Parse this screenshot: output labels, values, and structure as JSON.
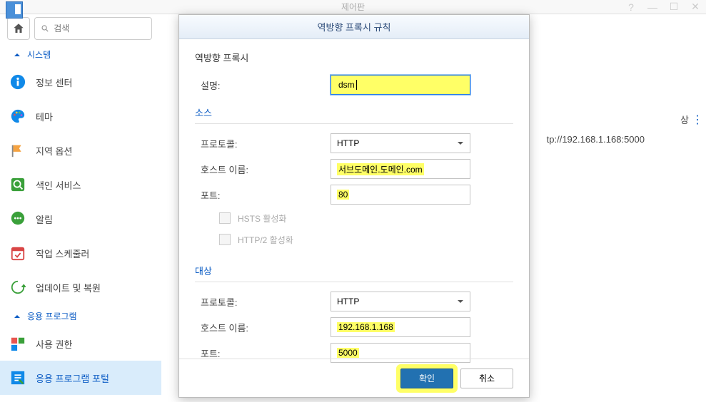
{
  "title": "제어판",
  "search_placeholder": "검색",
  "sidebar": {
    "sections": [
      {
        "label": "시스템",
        "collapsible": true
      }
    ],
    "items": [
      {
        "label": "정보 센터",
        "icon": "info"
      },
      {
        "label": "테마",
        "icon": "palette"
      },
      {
        "label": "지역 옵션",
        "icon": "flags"
      },
      {
        "label": "색인 서비스",
        "icon": "magnify"
      },
      {
        "label": "알림",
        "icon": "chat"
      },
      {
        "label": "작업 스케줄러",
        "icon": "calendar"
      },
      {
        "label": "업데이트 및 복원",
        "icon": "refresh"
      }
    ],
    "app_section_label": "응용 프로그램",
    "app_items": [
      {
        "label": "사용 권한",
        "icon": "perms"
      },
      {
        "label": "응용 프로그램 포털",
        "icon": "portal",
        "active": true
      }
    ]
  },
  "content": {
    "col_target": "상",
    "row_value": "tp://192.168.1.168:5000"
  },
  "modal": {
    "title": "역방향 프록시 규칙",
    "group": "역방향 프록시",
    "desc_label": "설명:",
    "desc_value": "dsm",
    "source_title": "소스",
    "protocol_label": "프로토콜:",
    "protocol_value": "HTTP",
    "host_label": "호스트 이름:",
    "src_host_value": "서브도메인.도메인.com",
    "port_label": "포트:",
    "src_port_value": "80",
    "hsts_label": "HSTS 활성화",
    "http2_label": "HTTP/2 활성화",
    "dest_title": "대상",
    "dest_host_value": "192.168.1.168",
    "dest_port_value": "5000",
    "ok_label": "확인",
    "cancel_label": "취소"
  }
}
